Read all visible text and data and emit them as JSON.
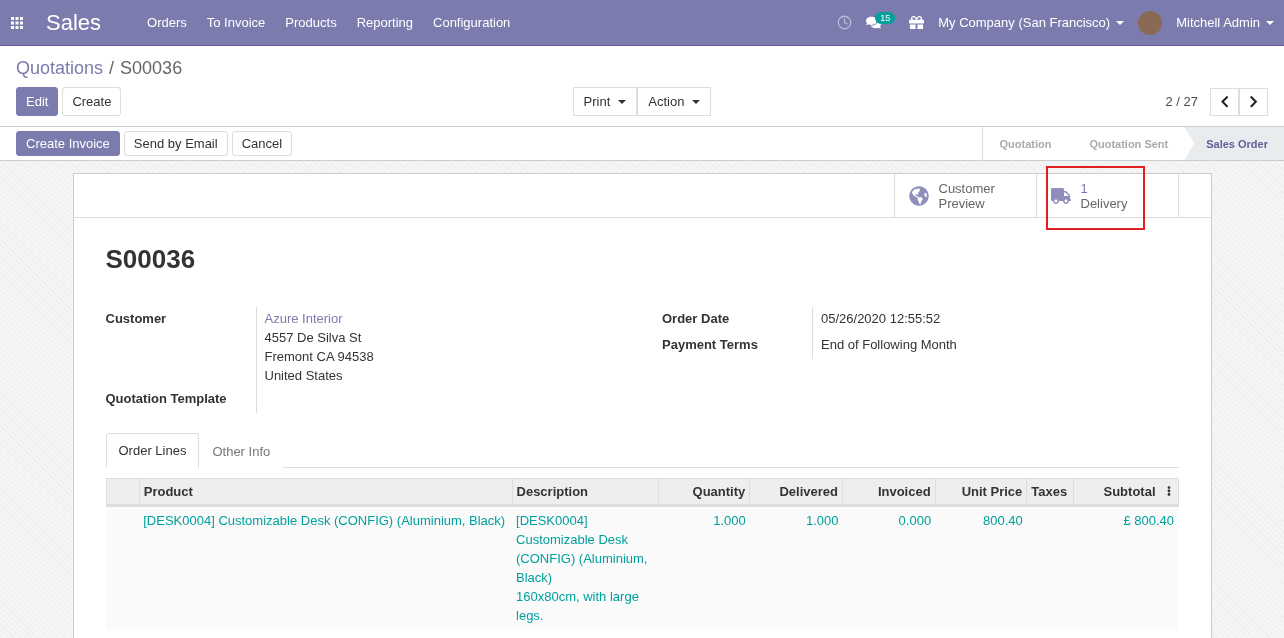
{
  "navbar": {
    "app": "Sales",
    "menu": [
      "Orders",
      "To Invoice",
      "Products",
      "Reporting",
      "Configuration"
    ],
    "messages_count": "15",
    "company": "My Company (San Francisco)",
    "user": "Mitchell Admin"
  },
  "breadcrumb": {
    "items": [
      "Quotations",
      "S00036"
    ],
    "separator": "/"
  },
  "buttons": [
    {
      "label": "Edit",
      "kind": "primary"
    },
    {
      "label": "Create",
      "kind": "secondary"
    }
  ],
  "dropdowns": [
    "Print",
    "Action"
  ],
  "pager": "2 / 27",
  "header_buttons": [
    {
      "label": "Create Invoice",
      "kind": "primary"
    },
    {
      "label": "Send by Email",
      "kind": "secondary"
    },
    {
      "label": "Cancel",
      "kind": "secondary"
    }
  ],
  "stages": [
    {
      "label": "Quotation",
      "selected": false
    },
    {
      "label": "Quotation Sent",
      "selected": false
    },
    {
      "label": "Sales Order",
      "selected": true
    }
  ],
  "stat_buttons": [
    {
      "kind": "globe",
      "lines": [
        "Customer",
        "Preview"
      ],
      "highlighted": false
    },
    {
      "kind": "truck",
      "value": "1",
      "lines": [
        "Delivery"
      ],
      "highlighted": true
    }
  ],
  "title": "S00036",
  "left_fields": [
    {
      "label": "Customer",
      "link": "Azure Interior",
      "values": [
        "4557 De Silva St",
        "Fremont CA 94538",
        "United States"
      ]
    },
    {
      "label": "Quotation Template"
    }
  ],
  "right_fields": [
    {
      "label": "Order Date",
      "values": [
        "05/26/2020 12:55:52"
      ]
    },
    {
      "label": "Payment Terms",
      "values": [
        "End of Following Month"
      ]
    }
  ],
  "tabs": [
    {
      "label": "Order Lines",
      "selected": true
    },
    {
      "label": "Other Info",
      "selected": false
    }
  ],
  "table": {
    "columns": [
      "Product",
      "Description",
      "Quantity",
      "Delivered",
      "Invoiced",
      "Unit Price",
      "Taxes",
      "Subtotal"
    ],
    "rows": [
      {
        "cells": [
          "[DESK0004] Customizable Desk (CONFIG) (Aluminium, Black)",
          "[DESK0004]\nCustomizable Desk (CONFIG) (Aluminium, Black)\n160x80cm, with large legs.",
          "1.000",
          "1.000",
          "0.000",
          "800.40",
          "",
          "£ 800.40"
        ]
      }
    ]
  }
}
